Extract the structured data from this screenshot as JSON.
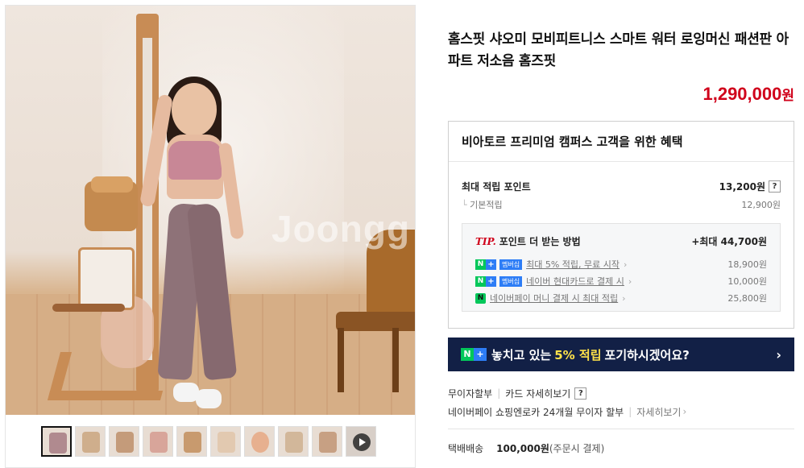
{
  "product": {
    "title": "홈스핏 샤오미 모비피트니스 스마트 워터 로잉머신 패션판 아파트 저소음 홈즈핏",
    "price": "1,290,000",
    "currency": "원",
    "watermark": "Joongg"
  },
  "benefit": {
    "header": "비아토르 프리미엄 캠퍼스 고객을 위한 혜택",
    "max_point_label": "최대 적립 포인트",
    "max_point_value": "13,200원",
    "q": "?",
    "base_label": "기본적립",
    "base_value": "12,900원",
    "tip": {
      "tip_label": "TIP.",
      "title": "포인트 더 받는 방법",
      "max": "+최대 44,700원",
      "rows": [
        {
          "badge": "멤버십",
          "text": "최대 5% 적립, 무료 시작",
          "value": "18,900원"
        },
        {
          "badge": "멤버십",
          "text": "네이버 현대카드로 결제 시",
          "value": "10,000원"
        },
        {
          "badge": "N pay",
          "text": "네이버페이 머니 결제 시 최대 적립",
          "value": "25,800원"
        }
      ]
    }
  },
  "banner": {
    "pre": "놓치고 있는",
    "highlight": "5% 적립",
    "post": "포기하시겠어요?",
    "arrow": "›"
  },
  "payment": {
    "installment": "무이자할부",
    "card_detail": "카드 자세히보기",
    "q": "?",
    "npay_line": "네이버페이 쇼핑엔로카 24개월 무이자 할부",
    "more": "자세히보기"
  },
  "shipping": {
    "label": "택배배송",
    "fee": "100,000원",
    "note": "(주문시 결제)"
  },
  "thumbnails": {
    "count": 10,
    "active_index": 0,
    "last_is_video": true
  },
  "colors": {
    "price_red": "#d0021b",
    "banner_navy": "#122046",
    "naver_green": "#03c75a",
    "highlight_yellow": "#ffe24a"
  }
}
